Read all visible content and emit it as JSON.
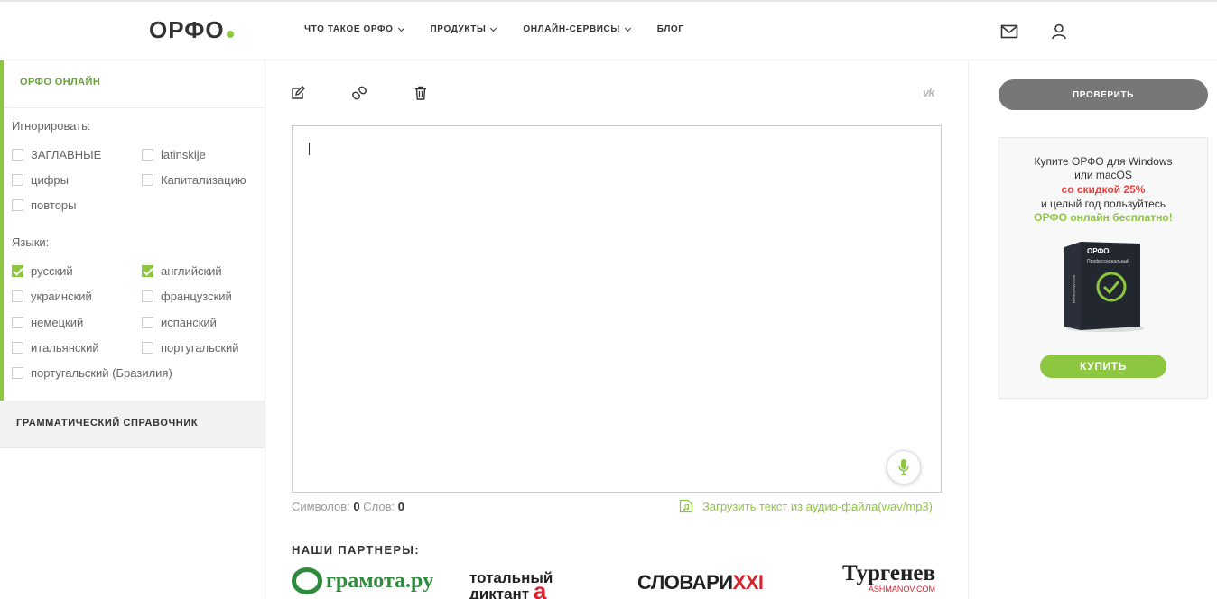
{
  "header": {
    "logo": "ОРФО",
    "nav": [
      {
        "label": "ЧТО ТАКОЕ ОРФО",
        "has_dropdown": true
      },
      {
        "label": "ПРОДУКТЫ",
        "has_dropdown": true
      },
      {
        "label": "ОНЛАЙН-СЕРВИСЫ",
        "has_dropdown": true
      },
      {
        "label": "БЛОГ",
        "has_dropdown": false
      }
    ],
    "icons": [
      "mail-icon",
      "user-icon"
    ]
  },
  "sidebar": {
    "title": "ОРФО ОНЛАЙН",
    "ignore_label": "Игнорировать:",
    "ignore_options": [
      {
        "label": "ЗАГЛАВНЫЕ",
        "checked": false
      },
      {
        "label": "latinskije",
        "checked": false
      },
      {
        "label": "цифры",
        "checked": false
      },
      {
        "label": "Капитализацию",
        "checked": false
      },
      {
        "label": "повторы",
        "checked": false
      }
    ],
    "languages_label": "Языки:",
    "languages": [
      {
        "label": "русский",
        "checked": true
      },
      {
        "label": "английский",
        "checked": true
      },
      {
        "label": "украинский",
        "checked": false
      },
      {
        "label": "французский",
        "checked": false
      },
      {
        "label": "немецкий",
        "checked": false
      },
      {
        "label": "испанский",
        "checked": false
      },
      {
        "label": "итальянский",
        "checked": false
      },
      {
        "label": "португальский",
        "checked": false
      },
      {
        "label": "португальский (Бразилия)",
        "checked": false
      }
    ],
    "grammar_label": "ГРАММАТИЧЕСКИЙ СПРАВОЧНИК"
  },
  "editor": {
    "toolbar_icons": [
      "edit-icon",
      "link-icon",
      "trash-icon",
      "vk-icon"
    ],
    "vk_label": "vk",
    "text": "",
    "chars_label": "Символов:",
    "chars_value": "0",
    "words_label": "Слов:",
    "words_value": "0",
    "upload_label": "Загрузить текст из аудио-файла(wav/mp3)"
  },
  "partners": {
    "title": "НАШИ ПАРТНЕРЫ:",
    "items": [
      {
        "name": "грамота.ру"
      },
      {
        "line1": "тотальный",
        "accent": "а",
        "line2": "диктант"
      },
      {
        "main": "СЛОВАРИ",
        "accent": "XXI"
      },
      {
        "main": "Тургенев",
        "sub": "ASHMANOV.COM"
      }
    ]
  },
  "right": {
    "check_label": "ПРОВЕРИТЬ",
    "promo_lines": [
      "Купите ОРФО для Windows",
      "или macOS",
      "со скидкой 25%",
      "и целый год пользуйтесь",
      "ОРФО онлайн бесплатно!"
    ],
    "box_title": "ОРФО.",
    "box_sub": "Профессиональный",
    "box_side": "ИНФОРМАТИК",
    "buy_label": "КУПИТЬ"
  },
  "colors": {
    "accent": "#8dc63f",
    "promo_red": "#e8403a",
    "button_gray": "#777777"
  }
}
